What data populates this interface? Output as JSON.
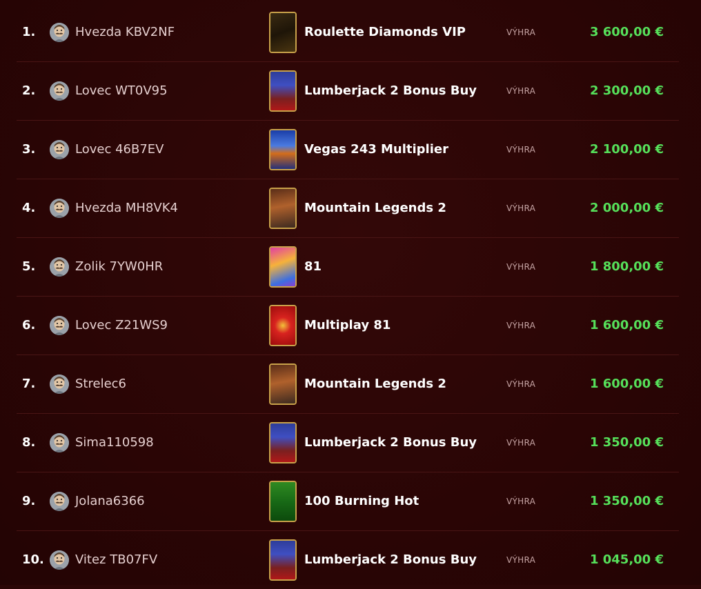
{
  "label_win": "VÝHRA",
  "rows": [
    {
      "rank": "1.",
      "player": "Hvezda KBV2NF",
      "game": "Roulette Diamonds VIP",
      "thumb": "roulette",
      "amount": "3 600,00 €"
    },
    {
      "rank": "2.",
      "player": "Lovec WT0V95",
      "game": "Lumberjack 2 Bonus Buy",
      "thumb": "lumber",
      "amount": "2 300,00 €"
    },
    {
      "rank": "3.",
      "player": "Lovec 46B7EV",
      "game": "Vegas 243 Multiplier",
      "thumb": "vegas",
      "amount": "2 100,00 €"
    },
    {
      "rank": "4.",
      "player": "Hvezda MH8VK4",
      "game": "Mountain Legends 2",
      "thumb": "mountain",
      "amount": "2 000,00 €"
    },
    {
      "rank": "5.",
      "player": "Zolik 7YW0HR",
      "game": "81",
      "thumb": "81",
      "amount": "1 800,00 €"
    },
    {
      "rank": "6.",
      "player": "Lovec Z21WS9",
      "game": "Multiplay 81",
      "thumb": "multi",
      "amount": "1 600,00 €"
    },
    {
      "rank": "7.",
      "player": "Strelec6",
      "game": "Mountain Legends 2",
      "thumb": "mountain",
      "amount": "1 600,00 €"
    },
    {
      "rank": "8.",
      "player": "Sima110598",
      "game": "Lumberjack 2 Bonus Buy",
      "thumb": "lumber",
      "amount": "1 350,00 €"
    },
    {
      "rank": "9.",
      "player": "Jolana6366",
      "game": "100 Burning Hot",
      "thumb": "burning",
      "amount": "1 350,00 €"
    },
    {
      "rank": "10.",
      "player": "Vitez TB07FV",
      "game": "Lumberjack 2 Bonus Buy",
      "thumb": "lumber",
      "amount": "1 045,00 €"
    }
  ],
  "colors": {
    "background": "#2a0606",
    "amount": "#56e05a",
    "thumb_border": "#c9a24a"
  },
  "icons": {
    "avatar": "mustache-avatar-icon"
  }
}
